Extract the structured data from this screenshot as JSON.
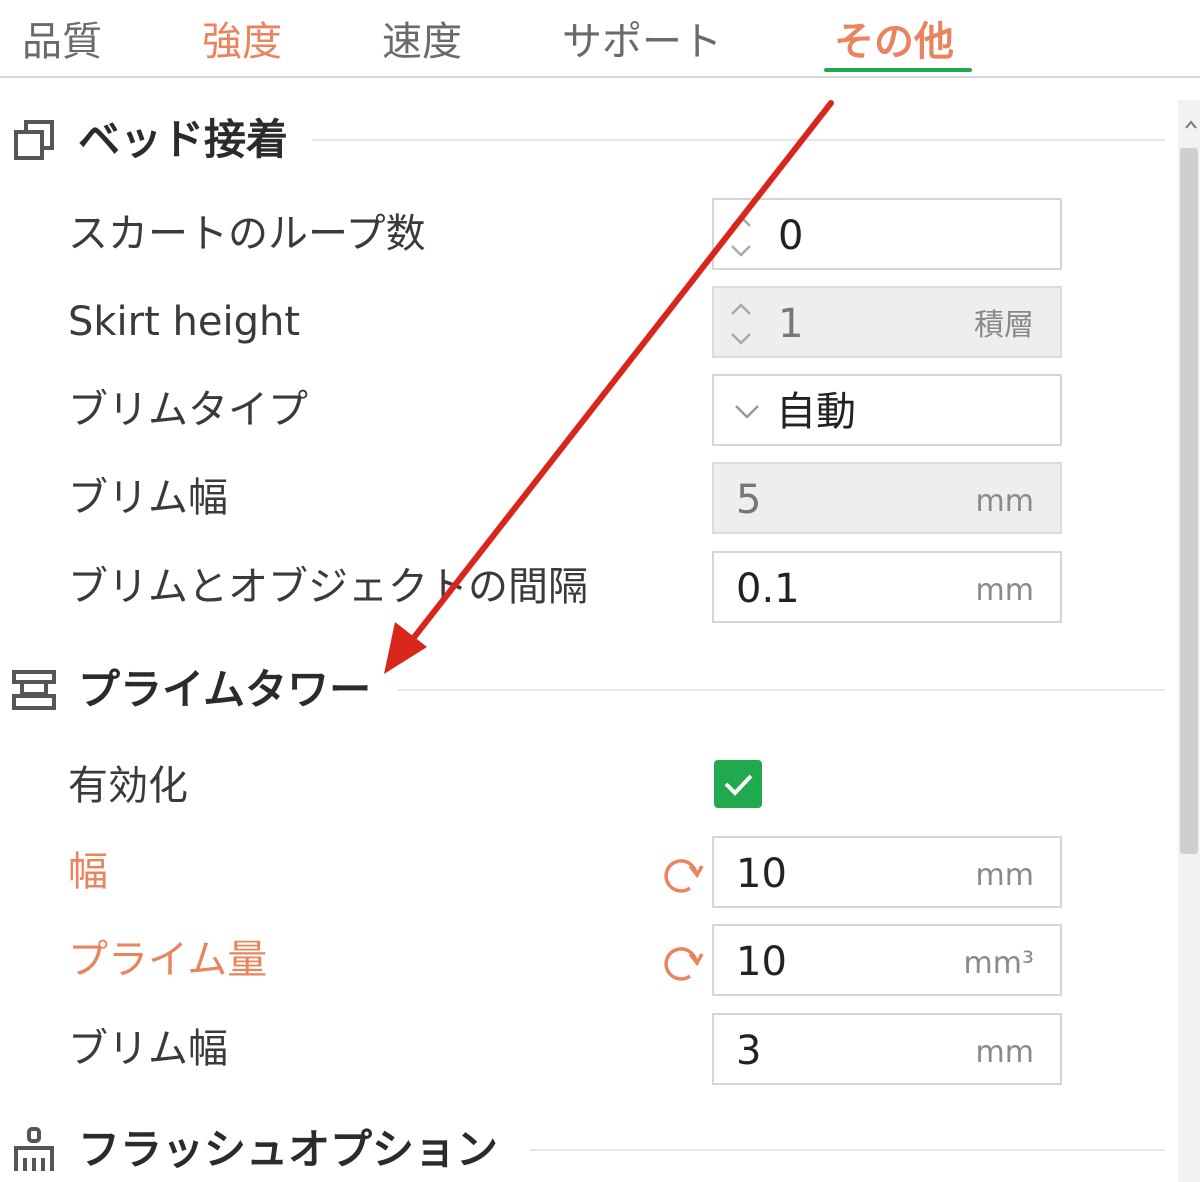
{
  "tabs": [
    {
      "label": "品質",
      "state": "normal"
    },
    {
      "label": "強度",
      "state": "modified"
    },
    {
      "label": "速度",
      "state": "normal"
    },
    {
      "label": "サポート",
      "state": "normal"
    },
    {
      "label": "その他",
      "state": "active"
    }
  ],
  "sections": {
    "bed_adhesion": {
      "title": "ベッド接着",
      "icon": "bed-adhesion-icon",
      "rows": [
        {
          "label": "スカートのループ数",
          "value": "0",
          "unit": "",
          "control": "spin",
          "enabled": true
        },
        {
          "label": "Skirt height",
          "value": "1",
          "unit": "積層",
          "control": "spin",
          "enabled": false
        },
        {
          "label": "ブリムタイプ",
          "value": "自動",
          "unit": "",
          "control": "select",
          "enabled": true
        },
        {
          "label": "ブリム幅",
          "value": "5",
          "unit": "mm",
          "control": "number",
          "enabled": false
        },
        {
          "label": "ブリムとオブジェクトの間隔",
          "value": "0.1",
          "unit": "mm",
          "control": "number",
          "enabled": true
        }
      ]
    },
    "prime_tower": {
      "title": "プライムタワー",
      "icon": "prime-tower-icon",
      "rows": [
        {
          "label": "有効化",
          "checked": true,
          "control": "checkbox"
        },
        {
          "label": "幅",
          "value": "10",
          "unit": "mm",
          "control": "number",
          "modified": true
        },
        {
          "label": "プライム量",
          "value": "10",
          "unit": "mm³",
          "control": "number",
          "modified": true
        },
        {
          "label": "ブリム幅",
          "value": "3",
          "unit": "mm",
          "control": "number",
          "modified": false
        }
      ]
    },
    "flush_options": {
      "title": "フラッシュオプション",
      "icon": "flush-brush-icon"
    }
  },
  "colors": {
    "accent_green": "#1faa4e",
    "modified_orange": "#e9845e",
    "annotation_red": "#d9261c"
  }
}
